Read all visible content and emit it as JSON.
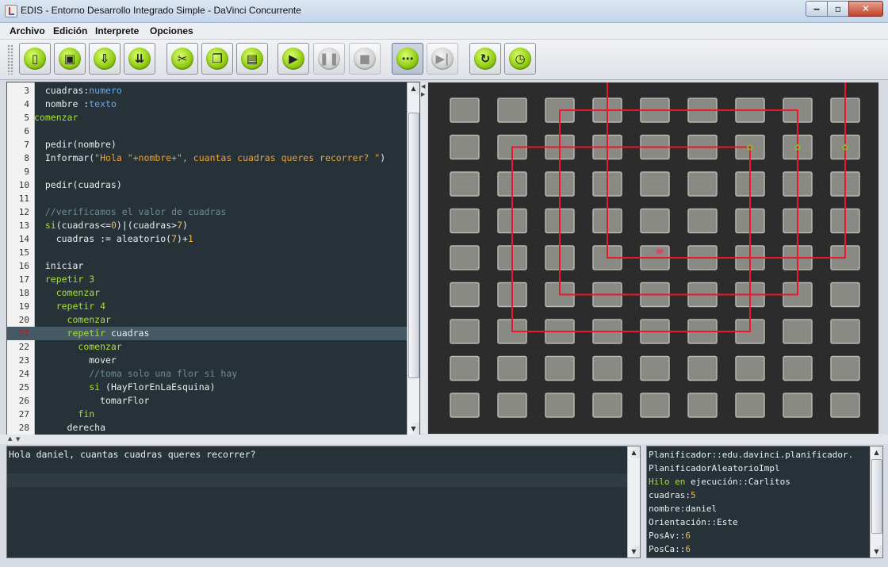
{
  "window": {
    "title": "EDIS - Entorno Desarrollo Integrado Simple - DaVinci Concurrente"
  },
  "menu": [
    "Archivo",
    "Edición",
    "Interprete",
    "Opciones"
  ],
  "toolbar": {
    "buttons": [
      {
        "icon": "new-file-icon",
        "enabled": true,
        "symbol": "▯"
      },
      {
        "icon": "open-file-icon",
        "enabled": true,
        "symbol": "▣"
      },
      {
        "icon": "save-file-icon",
        "enabled": true,
        "symbol": "⇩"
      },
      {
        "icon": "save-as-icon",
        "enabled": true,
        "symbol": "⇊"
      },
      {
        "icon": "cut-icon",
        "enabled": true,
        "symbol": "✂"
      },
      {
        "icon": "copy-icon",
        "enabled": true,
        "symbol": "❐"
      },
      {
        "icon": "paste-icon",
        "enabled": true,
        "symbol": "▤"
      },
      {
        "icon": "run-icon",
        "enabled": true,
        "symbol": "▶"
      },
      {
        "icon": "pause-icon",
        "enabled": false,
        "symbol": "❚❚"
      },
      {
        "icon": "stop-icon",
        "enabled": false,
        "symbol": "■"
      },
      {
        "icon": "concurrent-icon",
        "enabled": true,
        "toggled": true,
        "symbol": "⋯"
      },
      {
        "icon": "step-icon",
        "enabled": false,
        "symbol": "▶|"
      },
      {
        "icon": "reset-icon",
        "enabled": true,
        "symbol": "↻"
      },
      {
        "icon": "speed-clock-icon",
        "enabled": true,
        "symbol": "◷"
      }
    ]
  },
  "editor": {
    "current_line": 21,
    "lines": [
      {
        "n": 3,
        "tokens": [
          [
            "  ",
            ""
          ],
          [
            "cuadras:",
            ""
          ],
          [
            "numero",
            "type"
          ]
        ]
      },
      {
        "n": 4,
        "tokens": [
          [
            "  nombre :",
            ""
          ],
          [
            "texto",
            "type"
          ]
        ]
      },
      {
        "n": 5,
        "tokens": [
          [
            "comenzar",
            "kw"
          ]
        ]
      },
      {
        "n": 6,
        "tokens": []
      },
      {
        "n": 7,
        "tokens": [
          [
            "  pedir(nombre)",
            ""
          ]
        ]
      },
      {
        "n": 8,
        "tokens": [
          [
            "  Informar(",
            ""
          ],
          [
            "\"Hola \"+nombre+\", cuantas cuadras queres recorrer? \"",
            "str"
          ],
          [
            ")",
            ""
          ]
        ]
      },
      {
        "n": 9,
        "tokens": []
      },
      {
        "n": 10,
        "tokens": [
          [
            "  pedir(cuadras)",
            ""
          ]
        ]
      },
      {
        "n": 11,
        "tokens": []
      },
      {
        "n": 12,
        "tokens": [
          [
            "  //verificamos el valor de cuadras",
            "cmt"
          ]
        ]
      },
      {
        "n": 13,
        "tokens": [
          [
            "  ",
            ""
          ],
          [
            "si",
            "kw"
          ],
          [
            "(cuadras<=",
            ""
          ],
          [
            "0",
            "num"
          ],
          [
            ")|(cuadras>",
            ""
          ],
          [
            "7",
            "num"
          ],
          [
            ")",
            ""
          ]
        ]
      },
      {
        "n": 14,
        "tokens": [
          [
            "    cuadras := aleatorio(",
            ""
          ],
          [
            "7",
            "num"
          ],
          [
            ")+",
            ""
          ],
          [
            "1",
            "num"
          ]
        ]
      },
      {
        "n": 15,
        "tokens": []
      },
      {
        "n": 16,
        "tokens": [
          [
            "  iniciar",
            ""
          ]
        ]
      },
      {
        "n": 17,
        "tokens": [
          [
            "  ",
            ""
          ],
          [
            "repetir 3",
            "kw"
          ]
        ]
      },
      {
        "n": 18,
        "tokens": [
          [
            "    ",
            ""
          ],
          [
            "comenzar",
            "kw"
          ]
        ]
      },
      {
        "n": 19,
        "tokens": [
          [
            "    ",
            ""
          ],
          [
            "repetir 4",
            "kw"
          ]
        ]
      },
      {
        "n": 20,
        "tokens": [
          [
            "      ",
            ""
          ],
          [
            "comenzar",
            "kw"
          ]
        ]
      },
      {
        "n": 21,
        "tokens": [
          [
            "      ",
            ""
          ],
          [
            "repetir",
            "kw"
          ],
          [
            " cuadras",
            ""
          ]
        ]
      },
      {
        "n": 22,
        "tokens": [
          [
            "        ",
            ""
          ],
          [
            "comenzar",
            "kw"
          ]
        ]
      },
      {
        "n": 23,
        "tokens": [
          [
            "          mover",
            ""
          ]
        ]
      },
      {
        "n": 24,
        "tokens": [
          [
            "          //toma solo una flor si hay",
            "cmt"
          ]
        ]
      },
      {
        "n": 25,
        "tokens": [
          [
            "          ",
            ""
          ],
          [
            "si",
            "kw"
          ],
          [
            " (HayFlorEnLaEsquina)",
            ""
          ]
        ]
      },
      {
        "n": 26,
        "tokens": [
          [
            "            tomarFlor",
            ""
          ]
        ]
      },
      {
        "n": 27,
        "tokens": [
          [
            "        ",
            ""
          ],
          [
            "fin",
            "kw"
          ]
        ]
      },
      {
        "n": 28,
        "tokens": [
          [
            "      derecha",
            ""
          ]
        ]
      }
    ]
  },
  "output": {
    "text": "Hola daniel, cuantas cuadras queres recorrer?"
  },
  "variables": {
    "rows": [
      [
        [
          "Planificador::edu.davinci.planificador.",
          ""
        ]
      ],
      [
        [
          "PlanificadorAleatorioImpl",
          ""
        ]
      ],
      [
        [
          "Hilo en",
          "gr"
        ],
        [
          " ejecución::Carlitos",
          ""
        ]
      ],
      [
        [
          "cuadras:",
          ""
        ],
        [
          "5",
          "yl"
        ]
      ],
      [
        [
          "nombre:daniel",
          ""
        ]
      ],
      [
        [
          "Orientación::Este",
          ""
        ]
      ],
      [
        [
          "PosAv::",
          ""
        ],
        [
          "6",
          "yl"
        ]
      ],
      [
        [
          "PosCa::",
          ""
        ],
        [
          "6",
          "yl"
        ]
      ]
    ]
  },
  "city": {
    "avenues": 9,
    "streets": 9,
    "robot": {
      "avenue": 6,
      "street": 6
    },
    "path_rectangles": [
      {
        "from_av": 5,
        "to_av": 10,
        "from_st": 6,
        "to_st": 11
      },
      {
        "from_av": 4,
        "to_av": 9,
        "from_st": 5,
        "to_st": 10
      },
      {
        "from_av": 3,
        "to_av": 8,
        "from_st": 4,
        "to_st": 9
      }
    ],
    "flowers": [
      {
        "avenue": 7.5,
        "street": 8.5
      },
      {
        "avenue": 8.5,
        "street": 8.5
      },
      {
        "avenue": 9.5,
        "street": 8.5
      }
    ],
    "colors": {
      "path": "#e8192c",
      "block": "#8a8a84",
      "ground": "#2c2c2c",
      "robot": "#d0506a",
      "flower": "#7ec02a"
    }
  }
}
